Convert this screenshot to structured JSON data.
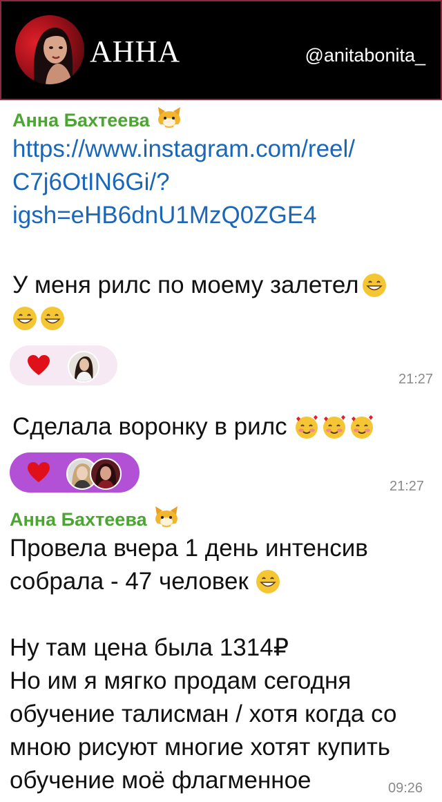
{
  "header": {
    "brand": "АННА",
    "handle": "@anitabonita_"
  },
  "messages": [
    {
      "sender": "Анна Бахтеева",
      "link_lines": [
        "https://www.instagram.com/reel/",
        "C7j6OtIN6Gi/?",
        "igsh=eHB6dnU1MzQ0ZGE4"
      ],
      "text_lines": [
        "У меня рилс по моему залетел",
        ""
      ],
      "reaction": "heart",
      "time": "21:27"
    },
    {
      "text_lines": [
        "Сделала воронку в рилс"
      ],
      "reaction": "heart",
      "time": "21:27"
    },
    {
      "sender": "Анна Бахтеева",
      "text_lines": [
        "Провела вчера 1 день интенсив",
        "собрала - 47 человек",
        "",
        "Ну там цена была 1314₽",
        "Но им я мягко продам сегодня",
        "обучение талисман / хотя когда со",
        "мною рисуют многие хотят купить",
        "обучение моё флагменное"
      ],
      "time": "09:26"
    }
  ],
  "colors": {
    "sender": "#4ca533",
    "link": "#1a66b8",
    "reaction_bg_1": "#f6e9f3",
    "reaction_bg_2": "#b351d6",
    "header_border": "#8a2a3c"
  },
  "icons": [
    "cat-emoji-icon",
    "grin-emoji-icon",
    "smiling-hearts-emoji-icon",
    "heart-icon"
  ]
}
